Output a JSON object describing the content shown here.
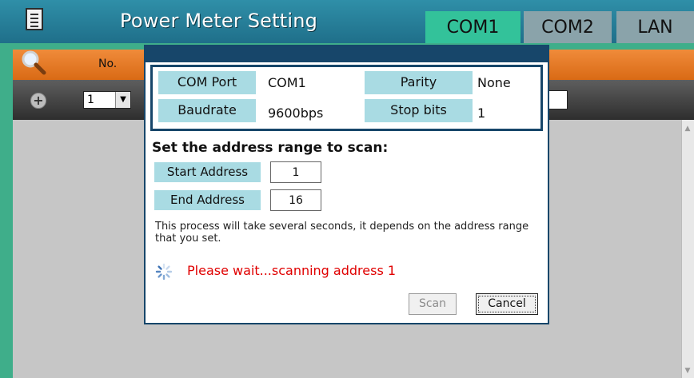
{
  "header": {
    "title": "Power Meter Setting",
    "tabs": [
      {
        "label": "COM1",
        "active": true
      },
      {
        "label": "COM2",
        "active": false
      },
      {
        "label": "LAN",
        "active": false
      }
    ],
    "icons": {
      "menu": "menu-list-icon"
    }
  },
  "toolbar": {
    "no_label": "No.",
    "search_icon": "search-icon",
    "add_icon": "plus-icon",
    "number_select": "1"
  },
  "dialog": {
    "info": {
      "com_port_label": "COM Port",
      "com_port_value": "COM1",
      "parity_label": "Parity",
      "parity_value": "None",
      "baudrate_label": "Baudrate",
      "baudrate_value": "9600bps",
      "stop_bits_label": "Stop bits",
      "stop_bits_value": "1"
    },
    "heading": "Set the address range to scan:",
    "start_address_label": "Start Address",
    "start_address_value": "1",
    "end_address_label": "End Address",
    "end_address_value": "16",
    "note": "This process will take several seconds, it depends on the address range that you set.",
    "status": "Please wait...scanning address 1",
    "scan_button": "Scan",
    "cancel_button": "Cancel"
  },
  "colors": {
    "header_bg": "#1f6f8a",
    "active_tab": "#33c29a",
    "inactive_tab": "#8aa3aa",
    "orange_bar": "#e67a25",
    "label_bg": "#a9dbe3",
    "dialog_border": "#17466a",
    "status_text": "#e00000"
  }
}
